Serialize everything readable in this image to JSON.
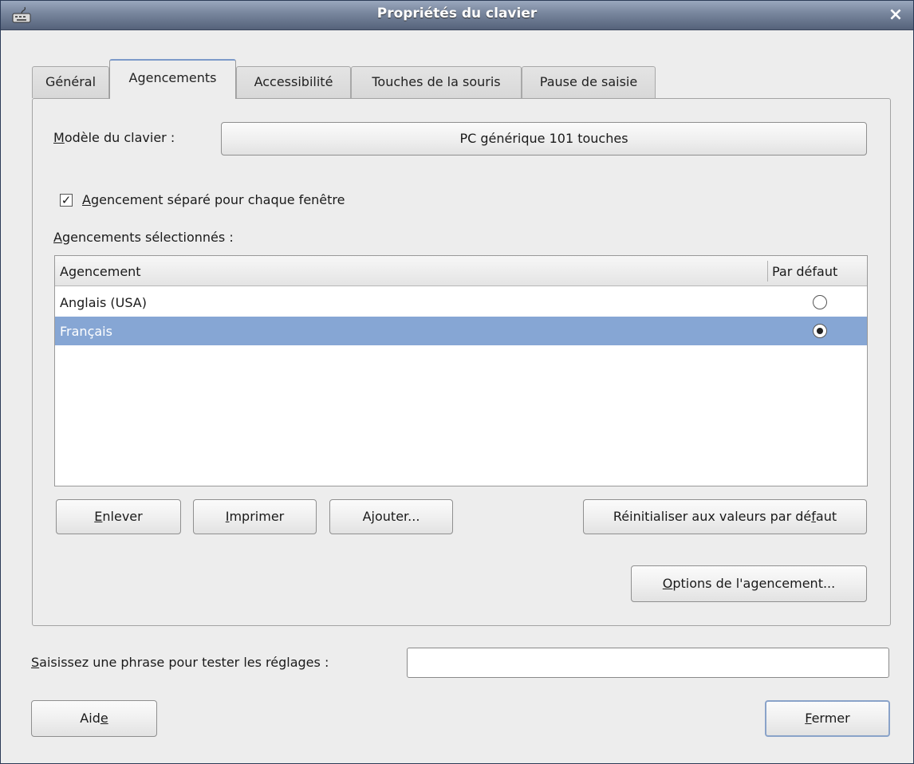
{
  "window": {
    "title": "Propriétés du clavier",
    "icon": "keyboard-icon",
    "close_glyph": "×"
  },
  "tabs": [
    {
      "label": "Général"
    },
    {
      "label": "Agencements",
      "active": true
    },
    {
      "label": "Accessibilité"
    },
    {
      "label": "Touches de la souris"
    },
    {
      "label": "Pause de saisie"
    }
  ],
  "layouts_tab": {
    "model_label_mnemonic": "M",
    "model_label_rest": "odèle du clavier :",
    "model_value": "PC générique 101 touches",
    "separate_layout_checked": true,
    "separate_layout_mnemonic": "A",
    "separate_layout_rest": "gencement séparé pour chaque fenêtre",
    "selected_label_mnemonic": "A",
    "selected_label_rest": "gencements sélectionnés :",
    "table": {
      "col_layout": "Agencement",
      "col_default": "Par défaut",
      "rows": [
        {
          "name": "Anglais (USA)",
          "default": false,
          "selected": false
        },
        {
          "name": "Français",
          "default": true,
          "selected": true
        }
      ]
    },
    "buttons": {
      "remove_m": "E",
      "remove_r": "nlever",
      "print_m": "I",
      "print_r": "mprimer",
      "add_a": "A",
      "add_m": "j",
      "add_r": "outer...",
      "reset_a": "Réinitialiser aux valeurs par dé",
      "reset_m": "f",
      "reset_r": "aut",
      "options_m": "O",
      "options_r": "ptions de l'agencement..."
    }
  },
  "test_field": {
    "label_m": "S",
    "label_r": "aisissez une phrase pour tester les réglages :",
    "value": ""
  },
  "footer": {
    "help_a": "Aid",
    "help_m": "e",
    "close_m": "F",
    "close_r": "ermer"
  },
  "colors": {
    "selection": "#86a6d4",
    "titlebar": "#6f7d96",
    "window_bg": "#ededed"
  }
}
